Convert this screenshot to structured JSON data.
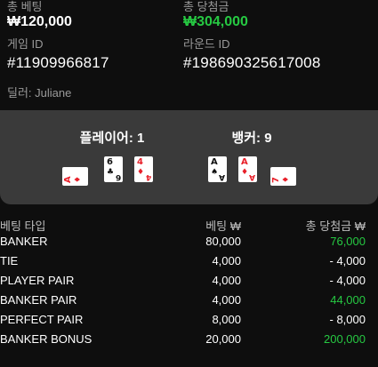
{
  "summary": {
    "total_bet_label": "총 베팅",
    "total_bet_value": "₩120,000",
    "total_win_label": "총 당첨금",
    "total_win_value": "₩304,000",
    "game_id_label": "게임 ID",
    "game_id_value": "#11909966817",
    "round_id_label": "라운드 ID",
    "round_id_value": "#198690325617008",
    "dealer_text": "딜러: Juliane"
  },
  "board": {
    "player_title": "플레이어: 1",
    "banker_title": "뱅커: 9",
    "player_cards": [
      {
        "rank": "A",
        "suit": "♦",
        "color": "red"
      },
      {
        "rank": "6",
        "suit": "♣",
        "color": "black"
      },
      {
        "rank": "4",
        "suit": "♦",
        "color": "red"
      }
    ],
    "banker_cards": [
      {
        "rank": "A",
        "suit": "♠",
        "color": "black"
      },
      {
        "rank": "A",
        "suit": "♦",
        "color": "red"
      },
      {
        "rank": "7",
        "suit": "♦",
        "color": "red"
      }
    ]
  },
  "table": {
    "headers": [
      "베팅 타입",
      "베팅 ₩",
      "총 당첨금 ₩"
    ],
    "rows": [
      {
        "type": "BANKER",
        "bet": "80,000",
        "win": "76,000",
        "win_positive": true
      },
      {
        "type": "TIE",
        "bet": "4,000",
        "win": "- 4,000",
        "win_positive": false
      },
      {
        "type": "PLAYER PAIR",
        "bet": "4,000",
        "win": "- 4,000",
        "win_positive": false
      },
      {
        "type": "BANKER PAIR",
        "bet": "4,000",
        "win": "44,000",
        "win_positive": true
      },
      {
        "type": "PERFECT PAIR",
        "bet": "8,000",
        "win": "- 8,000",
        "win_positive": false
      },
      {
        "type": "BANKER BONUS",
        "bet": "20,000",
        "win": "200,000",
        "win_positive": true
      }
    ]
  },
  "colors": {
    "positive": "#26c942",
    "board_bg": "#3a3a3a",
    "page_bg": "#0e0e0e"
  }
}
